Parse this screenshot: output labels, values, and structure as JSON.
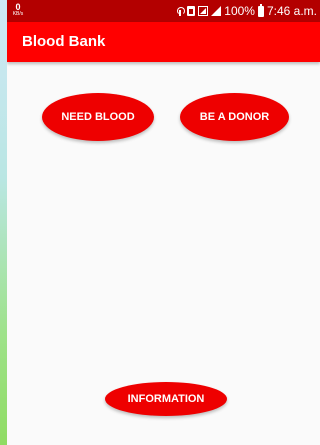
{
  "status_bar": {
    "network_speed": "0",
    "network_unit": "KB/s",
    "battery_percent": "100%",
    "time": "7:46 a.m.",
    "icons": [
      "hotspot-icon",
      "sim-icon",
      "signal-box-icon",
      "signal-icon",
      "battery-icon"
    ]
  },
  "app_bar": {
    "title": "Blood Bank"
  },
  "main": {
    "need_blood_label": "NEED BLOOD",
    "be_donor_label": "BE A DONOR",
    "information_label": "INFORMATION"
  },
  "colors": {
    "status_bar": "#b30000",
    "app_bar": "#ff0000",
    "button": "#ee0000",
    "background": "#fafafa"
  }
}
